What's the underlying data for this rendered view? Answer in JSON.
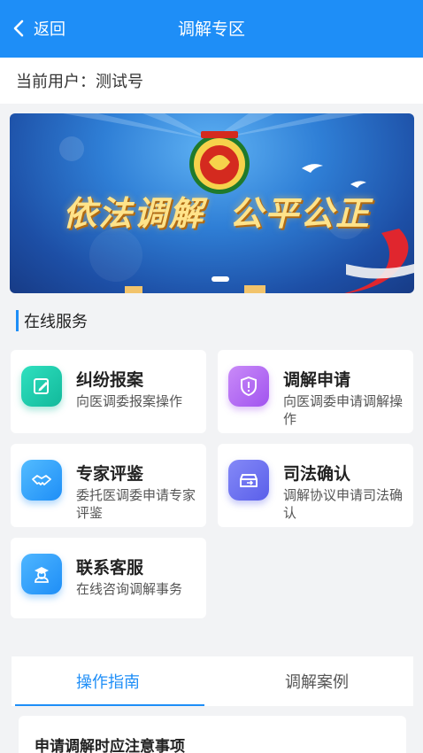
{
  "header": {
    "back_label": "返回",
    "title": "调解专区",
    "bg_color": "#1e8ef7"
  },
  "user": {
    "label": "当前用户：测试号"
  },
  "banner": {
    "slogan_left": "依法调解",
    "slogan_right": "公平公正",
    "slide_count_indicator": "1"
  },
  "online_services": {
    "title": "在线服务",
    "items": [
      {
        "title": "纠纷报案",
        "desc": "向医调委报案操作",
        "icon": "edit-icon",
        "color": "#1fd1b0"
      },
      {
        "title": "调解申请",
        "desc": "向医调委申请调解操作",
        "icon": "shield-alert-icon",
        "color": "#b86bf5"
      },
      {
        "title": "专家评鉴",
        "desc": "委托医调委申请专家评鉴",
        "icon": "handshake-icon",
        "color": "#3aa3f5"
      },
      {
        "title": "司法确认",
        "desc": "调解协议申请司法确认",
        "icon": "document-box-icon",
        "color": "#6c72f2"
      },
      {
        "title": "联系客服",
        "desc": "在线咨询调解事务",
        "icon": "agent-icon",
        "color": "#2f9cf3"
      }
    ]
  },
  "tabs": {
    "items": [
      "操作指南",
      "调解案例"
    ],
    "active": 0
  },
  "notice": {
    "title": "申请调解时应注意事项"
  }
}
